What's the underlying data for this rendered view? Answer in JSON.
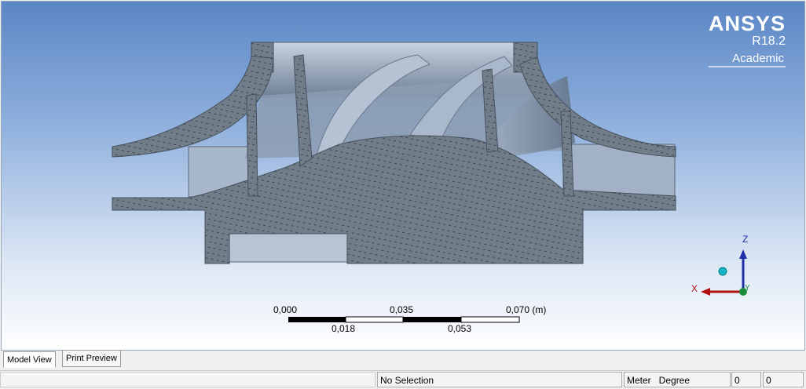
{
  "brand": {
    "name": "ANSYS",
    "version": "R18.2",
    "edition": "Academic"
  },
  "scale_bar": {
    "top_labels": [
      "0,000",
      "0,035",
      "0,070 (m)"
    ],
    "bottom_labels": [
      "0,018",
      "0,053"
    ]
  },
  "triad": {
    "z_label": "Z",
    "x_label": "X",
    "y_label": "Y"
  },
  "tabs": [
    {
      "label": "Model View",
      "active": true
    },
    {
      "label": "Print Preview",
      "active": false
    }
  ],
  "status": {
    "selection": "No Selection",
    "units": "Meter   Degree",
    "value_1": "0",
    "value_2": "0"
  },
  "colors": {
    "section_fill": "#717d89",
    "hatch": "#1b2430",
    "body_fill": "#9fb0c6",
    "triad_z": "#1e2fa8",
    "triad_x": "#b01212",
    "triad_y": "#1a8c3a"
  }
}
